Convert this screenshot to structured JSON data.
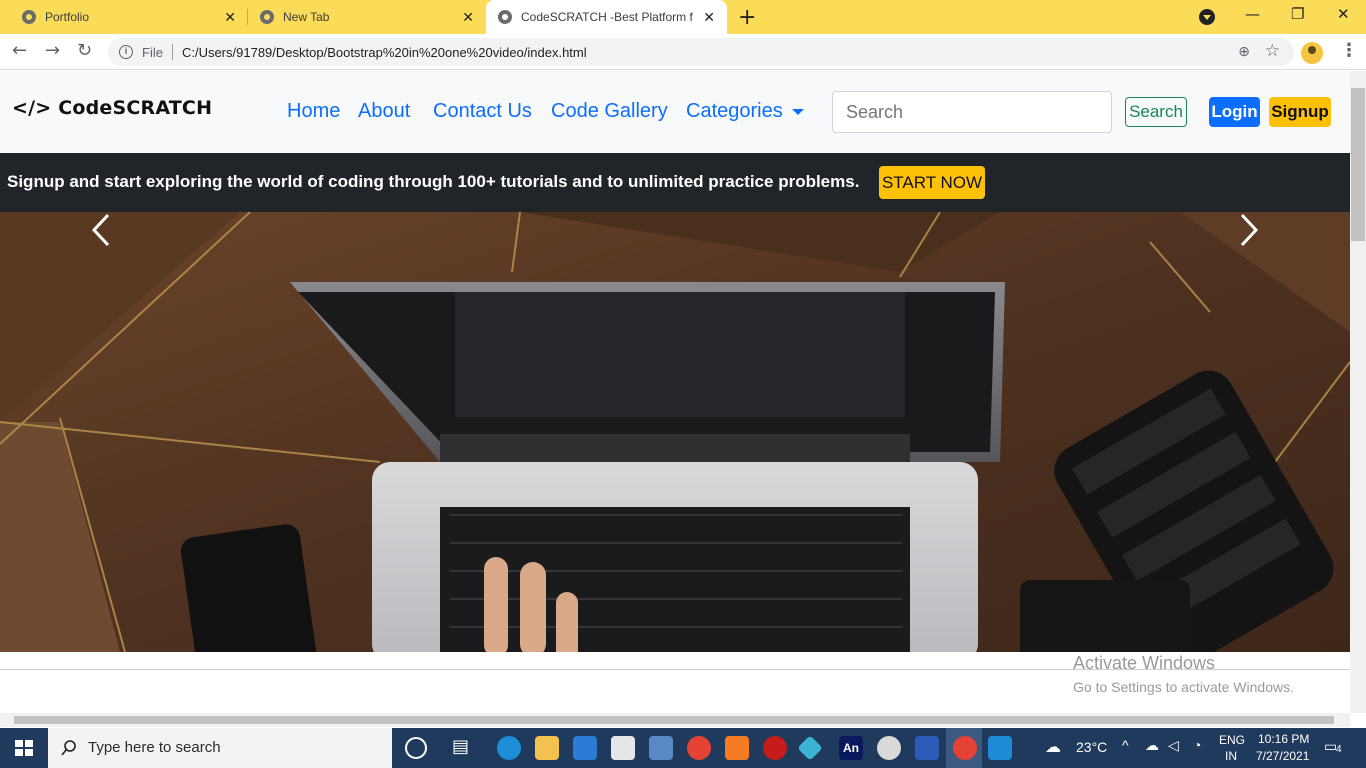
{
  "browser": {
    "tabs": [
      {
        "title": "Portfolio"
      },
      {
        "title": "New Tab"
      },
      {
        "title": "CodeSCRATCH -Best Platform for"
      }
    ],
    "omnibox": {
      "file_label": "File",
      "url": "C:/Users/91789/Desktop/Bootstrap%20in%20one%20video/index.html"
    }
  },
  "navbar": {
    "brand": "</> CodeSCRATCH",
    "links": [
      "Home",
      "About",
      "Contact Us",
      "Code Gallery",
      "Categories"
    ],
    "search_placeholder": "Search",
    "search_button": "Search",
    "login_button": "Login",
    "signup_button": "Signup"
  },
  "promo": {
    "text": "Signup and start exploring the world of coding through 100+ tutorials and to unlimited practice problems.",
    "button": "START NOW"
  },
  "watermark": {
    "line1": "Activate Windows",
    "line2": "Go to Settings to activate Windows."
  },
  "taskbar": {
    "search_placeholder": "Type here to search",
    "weather": "23°C",
    "lang": "ENG",
    "region": "IN",
    "time": "10:16 PM",
    "date": "7/27/2021",
    "notifications": "4",
    "pinned_apps": [
      "cortana-icon",
      "task-view-icon",
      "edge-icon",
      "file-explorer-icon",
      "mail-icon",
      "store-icon",
      "control-panel-icon",
      "chrome-icon",
      "xampp-icon",
      "brave-icon",
      "app-icon",
      "animate-icon",
      "app-icon",
      "word-icon",
      "chrome-icon",
      "vscode-icon"
    ]
  },
  "colors": {
    "tabstrip": "#fbdc58",
    "primary": "#0d6efd",
    "warning": "#ffc107",
    "success": "#198754",
    "dark": "#212529",
    "taskbar": "#1f3a5c"
  }
}
